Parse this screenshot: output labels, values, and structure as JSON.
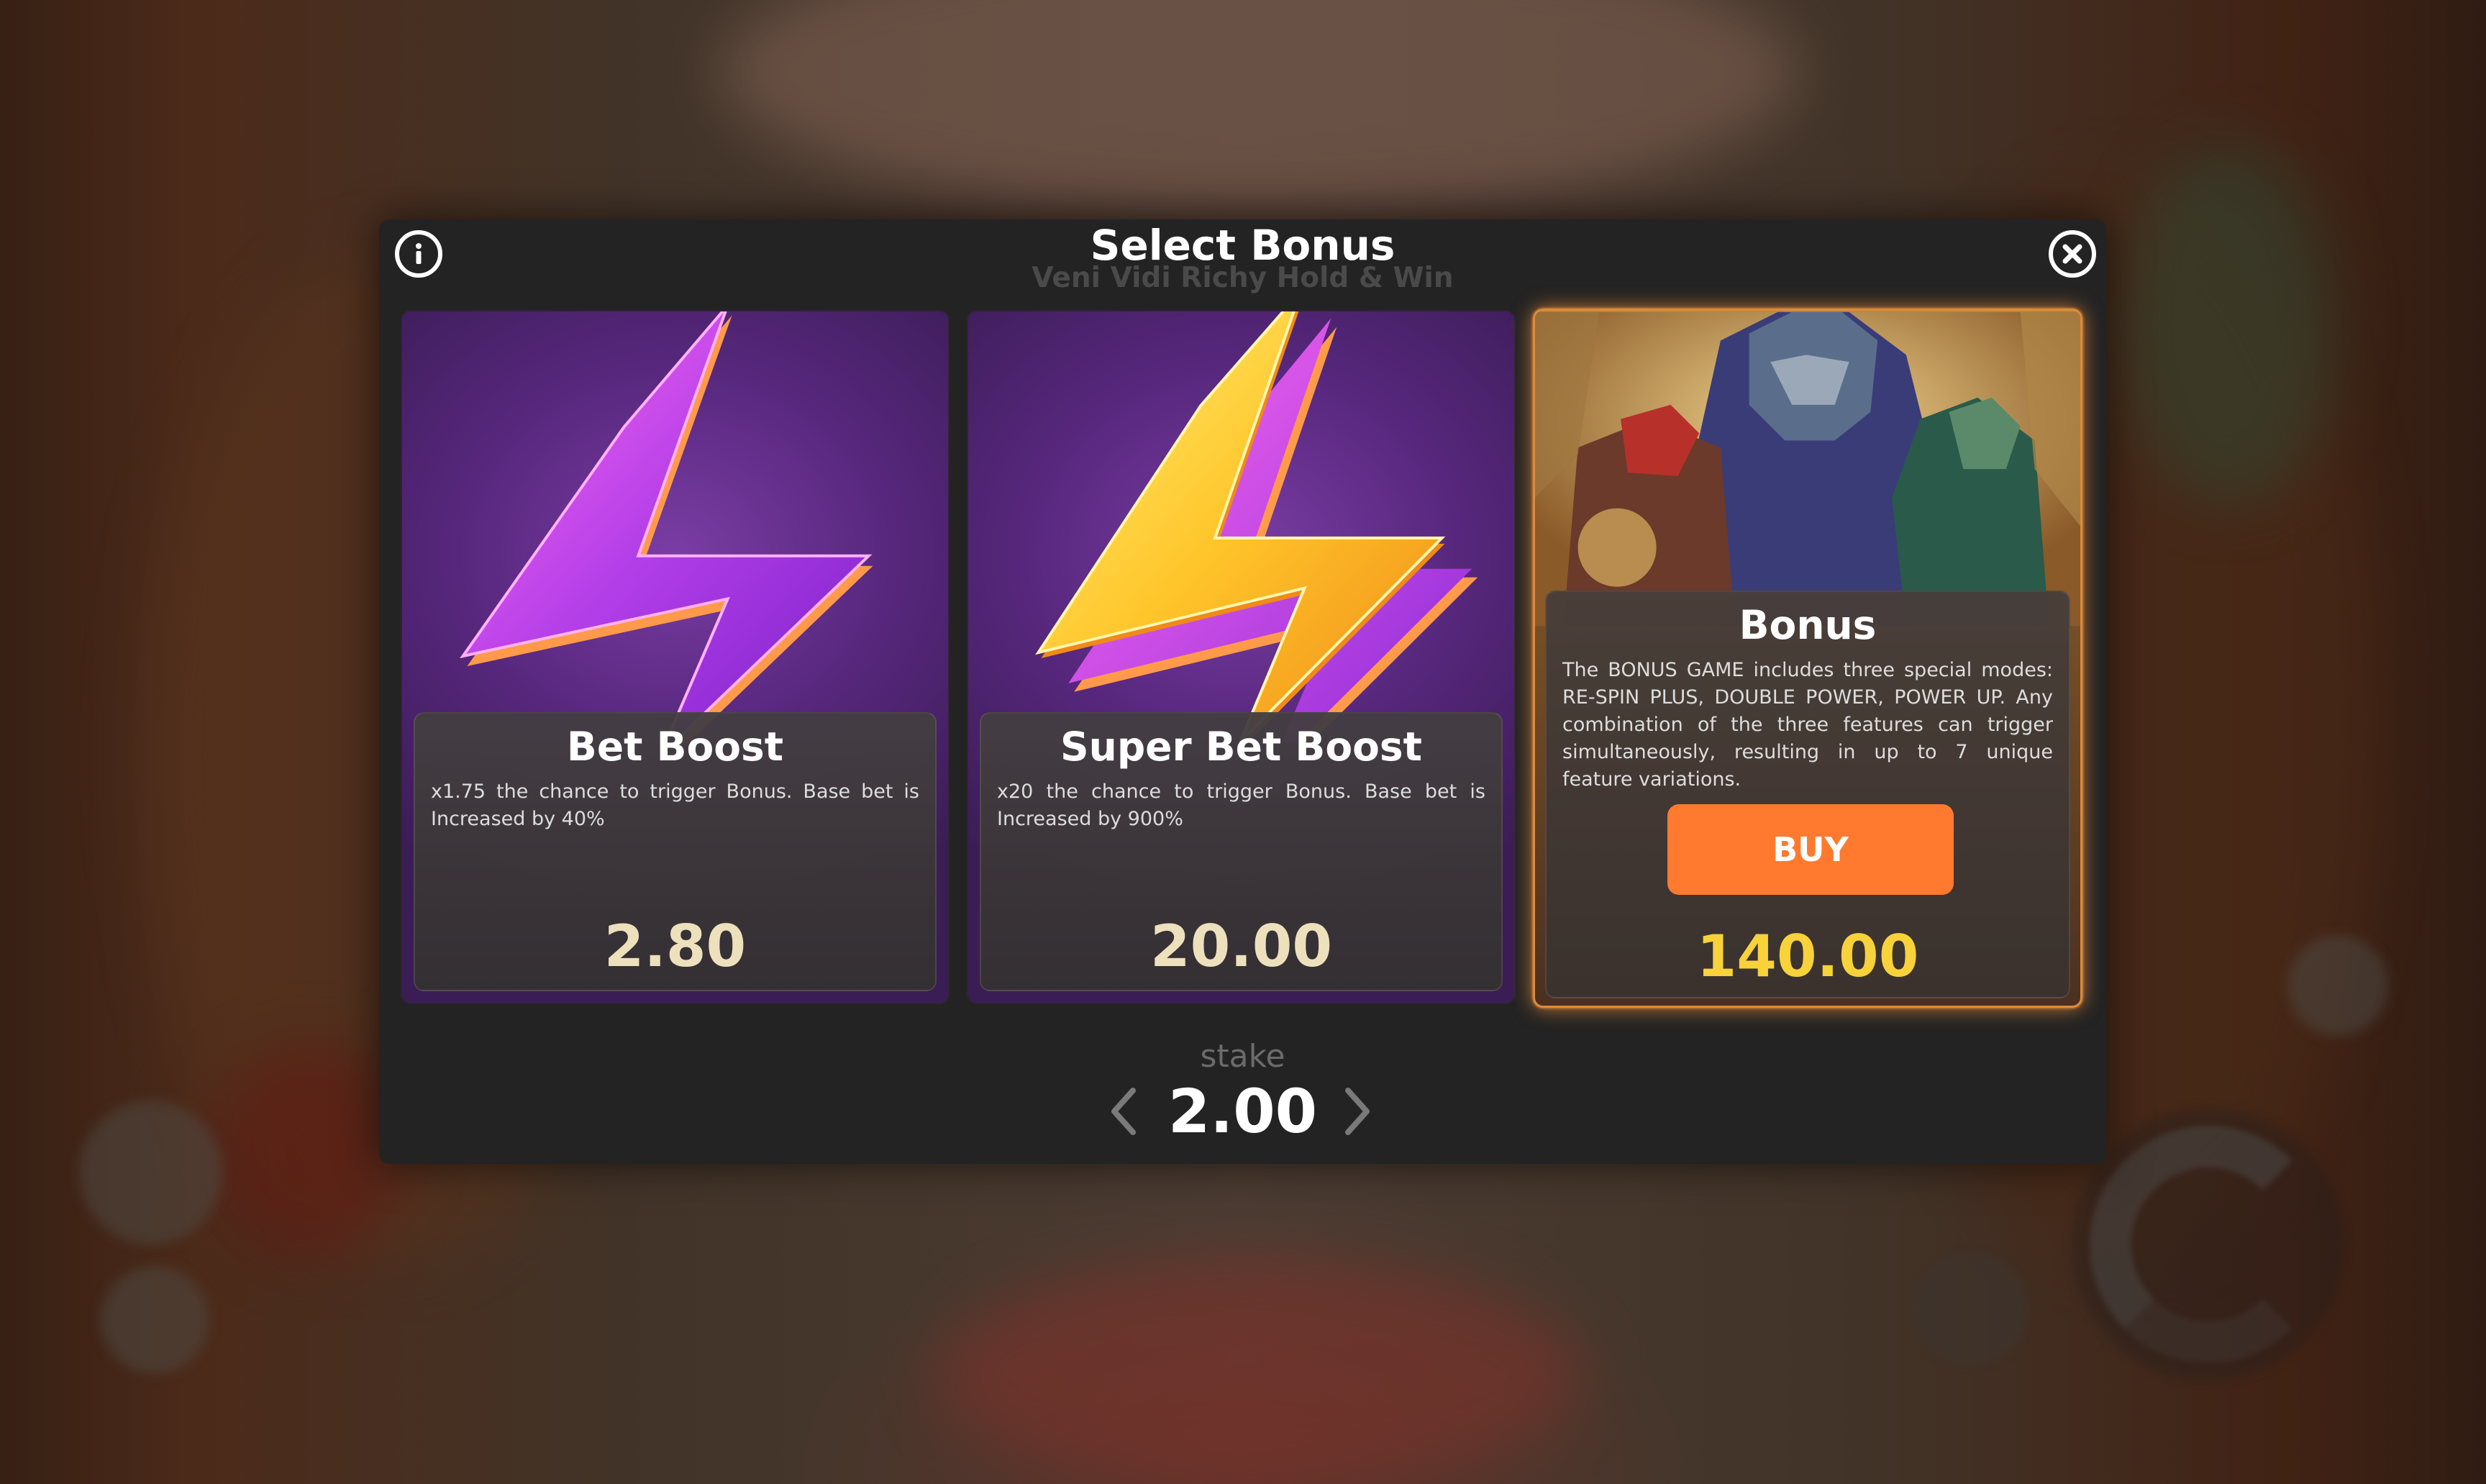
{
  "modal": {
    "title": "Select Bonus",
    "subtitle": "Veni Vidi Richy Hold & Win",
    "info_icon": "info-icon",
    "close_icon": "close-icon"
  },
  "cards": [
    {
      "title": "Bet Boost",
      "description": "x1.75 the chance to trigger Bonus. Base bet is Increased by 40%",
      "price": "2.80",
      "icon": "purple-lightning-bolt"
    },
    {
      "title": "Super Bet Boost",
      "description": "x20 the chance to trigger Bonus. Base bet is Increased by 900%",
      "price": "20.00",
      "icon": "gold-lightning-bolt"
    },
    {
      "title": "Bonus",
      "description": "The BONUS GAME includes three special modes: RE-SPIN PLUS, DOUBLE POWER, POWER UP. Any combination of the three features can trigger simultaneously, resulting in up to 7 unique feature variations.",
      "buy_label": "BUY",
      "price": "140.00",
      "icon": "bonus-characters-art"
    }
  ],
  "stake": {
    "label": "stake",
    "value": "2.00"
  },
  "colors": {
    "accent": "#ff7a2e",
    "bonus_price": "#f7d23a",
    "price": "#ede0bd",
    "modal_bg": "#232323"
  }
}
